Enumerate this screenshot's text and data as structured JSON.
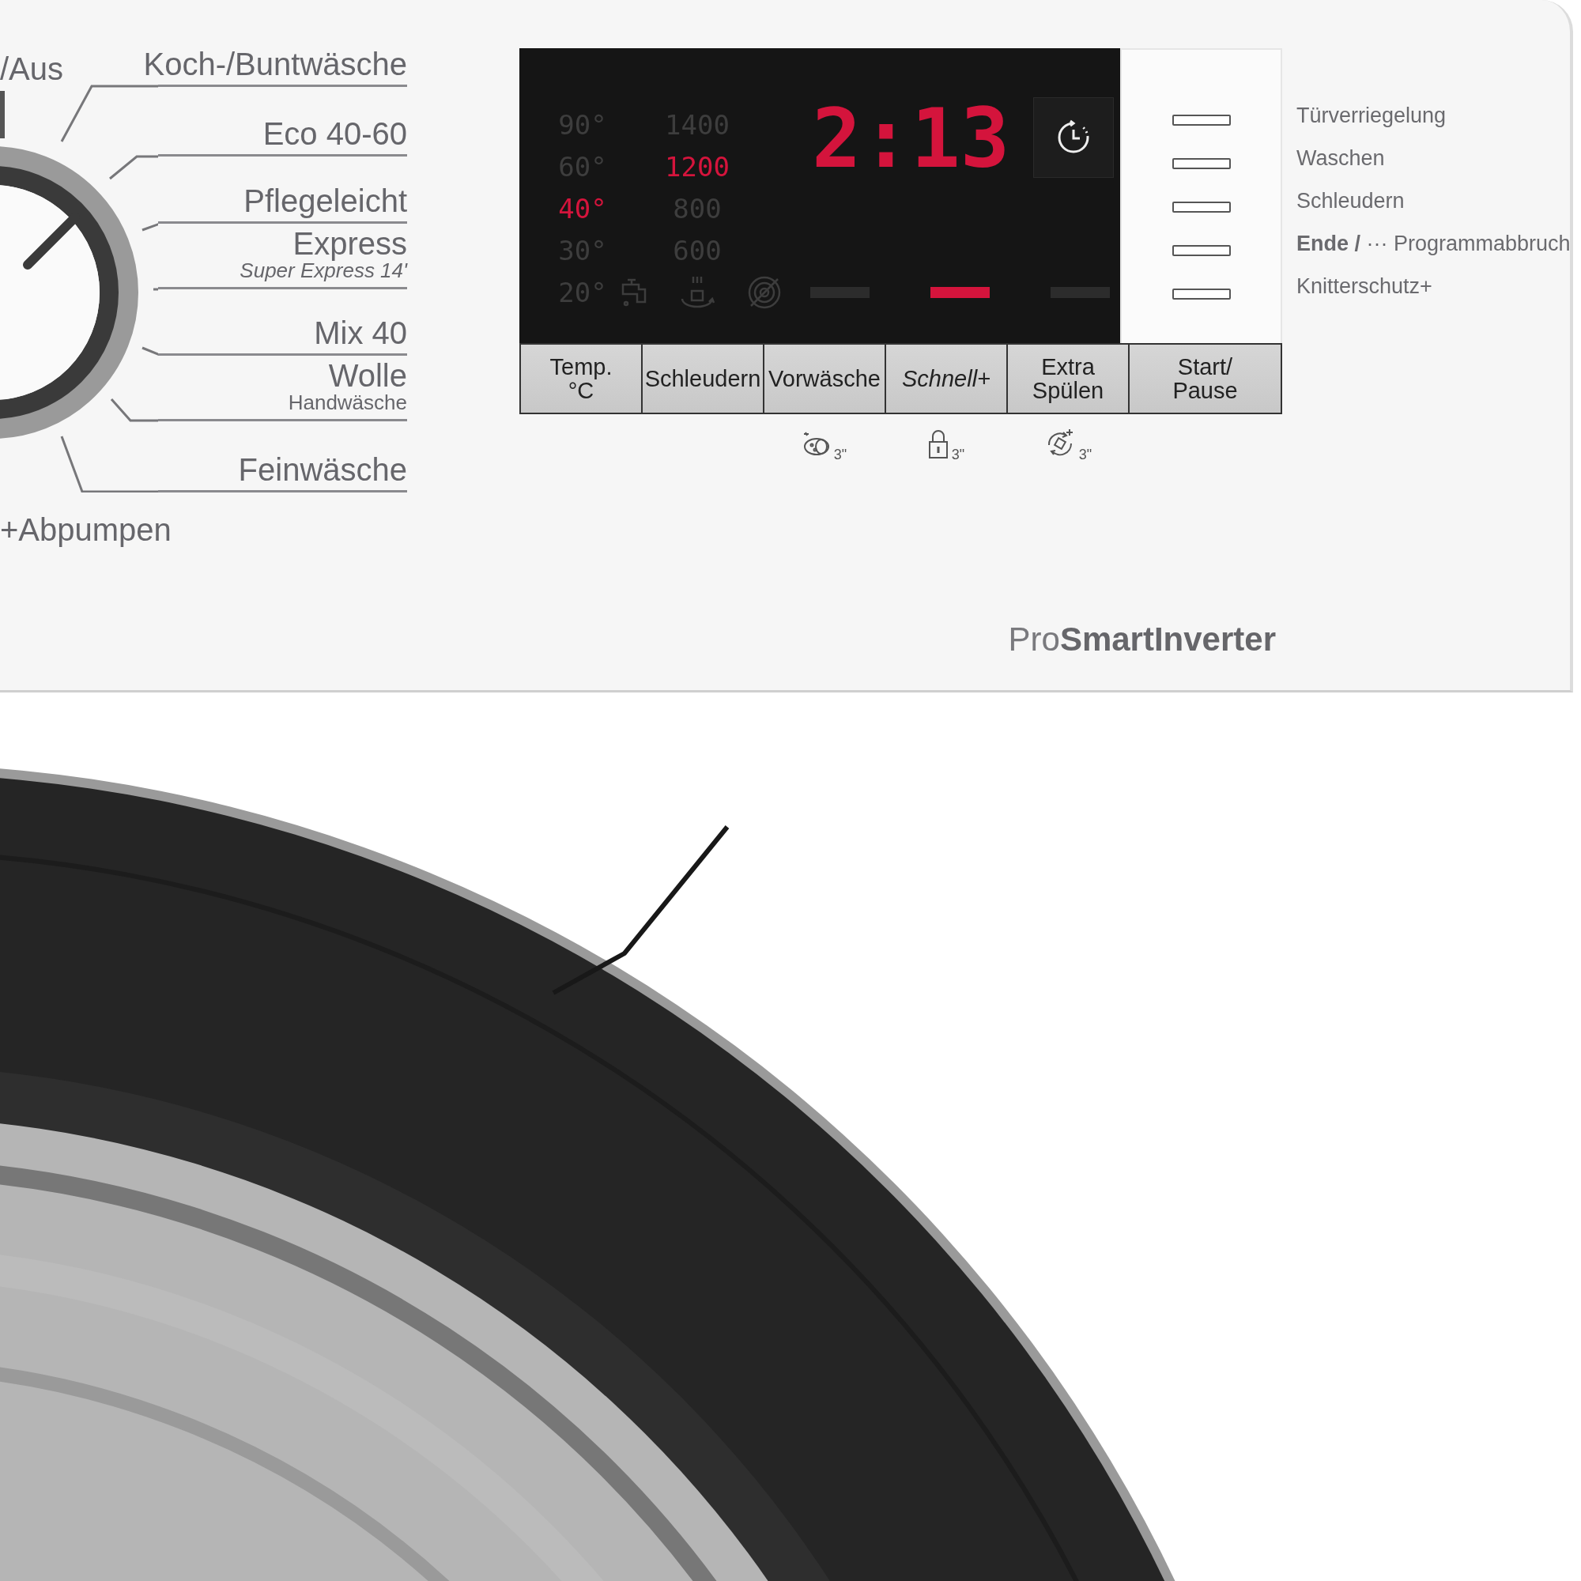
{
  "program_dial": {
    "top_left_label": "/Aus",
    "bottom_left_label": "+Abpumpen",
    "programs": [
      {
        "name": "Koch-/Buntwäsche"
      },
      {
        "name": "Eco 40-60"
      },
      {
        "name": "Pflegeleicht"
      },
      {
        "name": "Express",
        "subtitle": "Super Express 14'",
        "subtitle_italic": true
      },
      {
        "name": "Mix 40"
      },
      {
        "name": "Wolle",
        "subtitle": "Handwäsche",
        "subtitle_italic": false
      },
      {
        "name": "Feinwäsche"
      }
    ]
  },
  "display": {
    "temperatures": [
      {
        "label": "90°",
        "selected": false
      },
      {
        "label": "60°",
        "selected": false
      },
      {
        "label": "40°",
        "selected": true
      },
      {
        "label": "30°",
        "selected": false
      },
      {
        "label": "20°",
        "selected": false
      }
    ],
    "spin_speeds": [
      {
        "label": "1400",
        "selected": false
      },
      {
        "label": "1200",
        "selected": true
      },
      {
        "label": "800",
        "selected": false
      },
      {
        "label": "600",
        "selected": false
      }
    ],
    "time": "2:13",
    "phase_bars": [
      {
        "selected": false
      },
      {
        "selected": true
      },
      {
        "selected": false
      }
    ]
  },
  "buttons": [
    {
      "label": "Temp.\n°C",
      "italic": false
    },
    {
      "label": "Schleudern",
      "italic": false
    },
    {
      "label": "Vorwäsche",
      "italic": false,
      "hint": {
        "kind": "clean",
        "text": "3\""
      }
    },
    {
      "label": "Schnell+",
      "italic": true,
      "hint": {
        "kind": "lock",
        "text": "3\""
      }
    },
    {
      "label": "Extra\nSpülen",
      "italic": false,
      "hint": {
        "kind": "rinse",
        "text": "3\""
      }
    },
    {
      "label": "Start/\nPause",
      "italic": false
    }
  ],
  "status_indicators": [
    {
      "label": "Türverriegelung"
    },
    {
      "label": "Waschen"
    },
    {
      "label": "Schleudern"
    },
    {
      "label": "**Ende /** ··· Programmabbruch"
    },
    {
      "label": "Knitterschutz+"
    }
  ],
  "brand": "Pro**SmartInverter**"
}
